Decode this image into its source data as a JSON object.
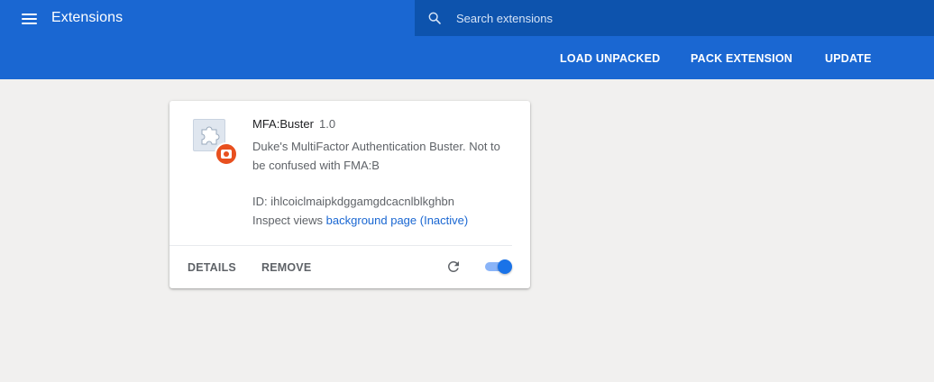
{
  "header": {
    "title": "Extensions",
    "search_placeholder": "Search extensions",
    "search_value": ""
  },
  "toolbar": {
    "load_unpacked": "LOAD UNPACKED",
    "pack_extension": "PACK EXTENSION",
    "update": "UPDATE"
  },
  "extension": {
    "name": "MFA:Buster",
    "version": "1.0",
    "description": "Duke's MultiFactor Authentication Buster. Not to be confused with FMA:B",
    "id_label": "ID: ihlcoiclmaipkdggamgdcacnlblkghbn",
    "inspect_label": "Inspect views",
    "inspect_link": "background page (Inactive)",
    "details_label": "DETAILS",
    "remove_label": "REMOVE",
    "enabled": true,
    "icon": "puzzle-piece-icon",
    "badge_icon": "record-badge-icon"
  },
  "colors": {
    "header_blue": "#1a67d2",
    "search_blue": "#0d53ad",
    "link_blue": "#1a67d2",
    "toggle_on": "#1a73e8",
    "badge_orange": "#e8501f"
  }
}
